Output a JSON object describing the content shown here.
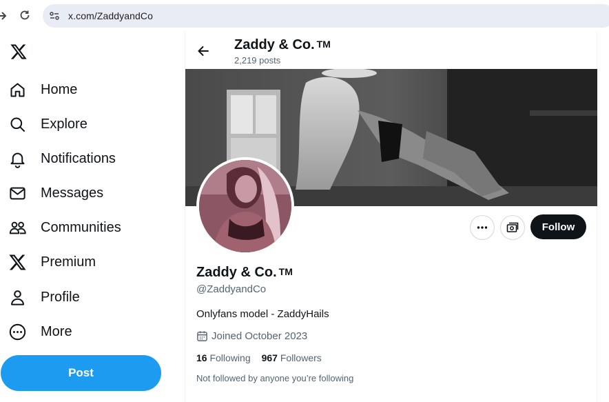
{
  "browser": {
    "url": "x.com/ZaddyandCo"
  },
  "sidebar": {
    "items": [
      {
        "label": "Home",
        "icon": "home-icon"
      },
      {
        "label": "Explore",
        "icon": "search-icon"
      },
      {
        "label": "Notifications",
        "icon": "bell-icon"
      },
      {
        "label": "Messages",
        "icon": "envelope-icon"
      },
      {
        "label": "Communities",
        "icon": "people-icon"
      },
      {
        "label": "Premium",
        "icon": "x-logo-icon"
      },
      {
        "label": "Profile",
        "icon": "person-icon"
      },
      {
        "label": "More",
        "icon": "more-circle-icon"
      }
    ],
    "post_label": "Post"
  },
  "header": {
    "name": "Zaddy & Co.",
    "tm": "TM",
    "posts": "2,219 posts"
  },
  "profile": {
    "name": "Zaddy & Co.",
    "tm": "TM",
    "handle": "@ZaddyandCo",
    "bio": "Onlyfans model - ZaddyHails",
    "joined": "Joined October 2023",
    "following_count": "16",
    "following_label": "Following",
    "followers_count": "967",
    "followers_label": "Followers",
    "not_followed": "Not followed by anyone you’re following",
    "follow_label": "Follow"
  },
  "colors": {
    "accent": "#1d9bf0",
    "text": "#0f1419",
    "muted": "#536471"
  }
}
